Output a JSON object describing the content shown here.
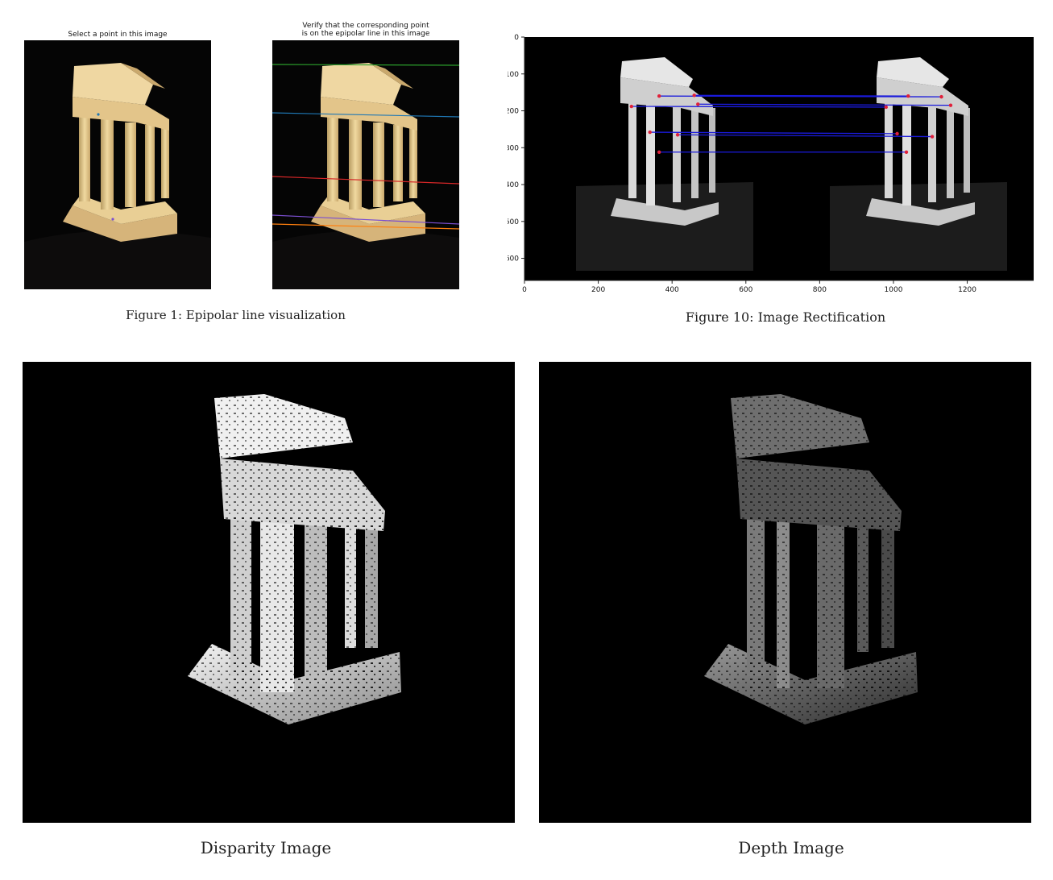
{
  "fig1": {
    "left_title": "Select a point in this image",
    "right_title": "Verify that the corresponding point\nis on the epipolar line in this image",
    "caption": "Figure 1: Epipolar line visualization",
    "line_colors": [
      "#2ca02c",
      "#1f77b4",
      "#d62728",
      "#7b4fd0",
      "#ff7f0e"
    ]
  },
  "fig10": {
    "caption": "Figure 10: Image Rectification",
    "match_line_color": "#1a1adb",
    "point_color": "#e0203a"
  },
  "chart_data": {
    "type": "scatter",
    "x_ticks": [
      "0",
      "200",
      "400",
      "600",
      "800",
      "1000",
      "1200"
    ],
    "y_ticks": [
      "0",
      "100",
      "200",
      "300",
      "400",
      "500",
      "600"
    ],
    "xlim": [
      0,
      1380
    ],
    "ylim": [
      660,
      0
    ]
  },
  "bottom": {
    "disparity_caption": "Disparity Image",
    "depth_caption": "Depth Image"
  }
}
